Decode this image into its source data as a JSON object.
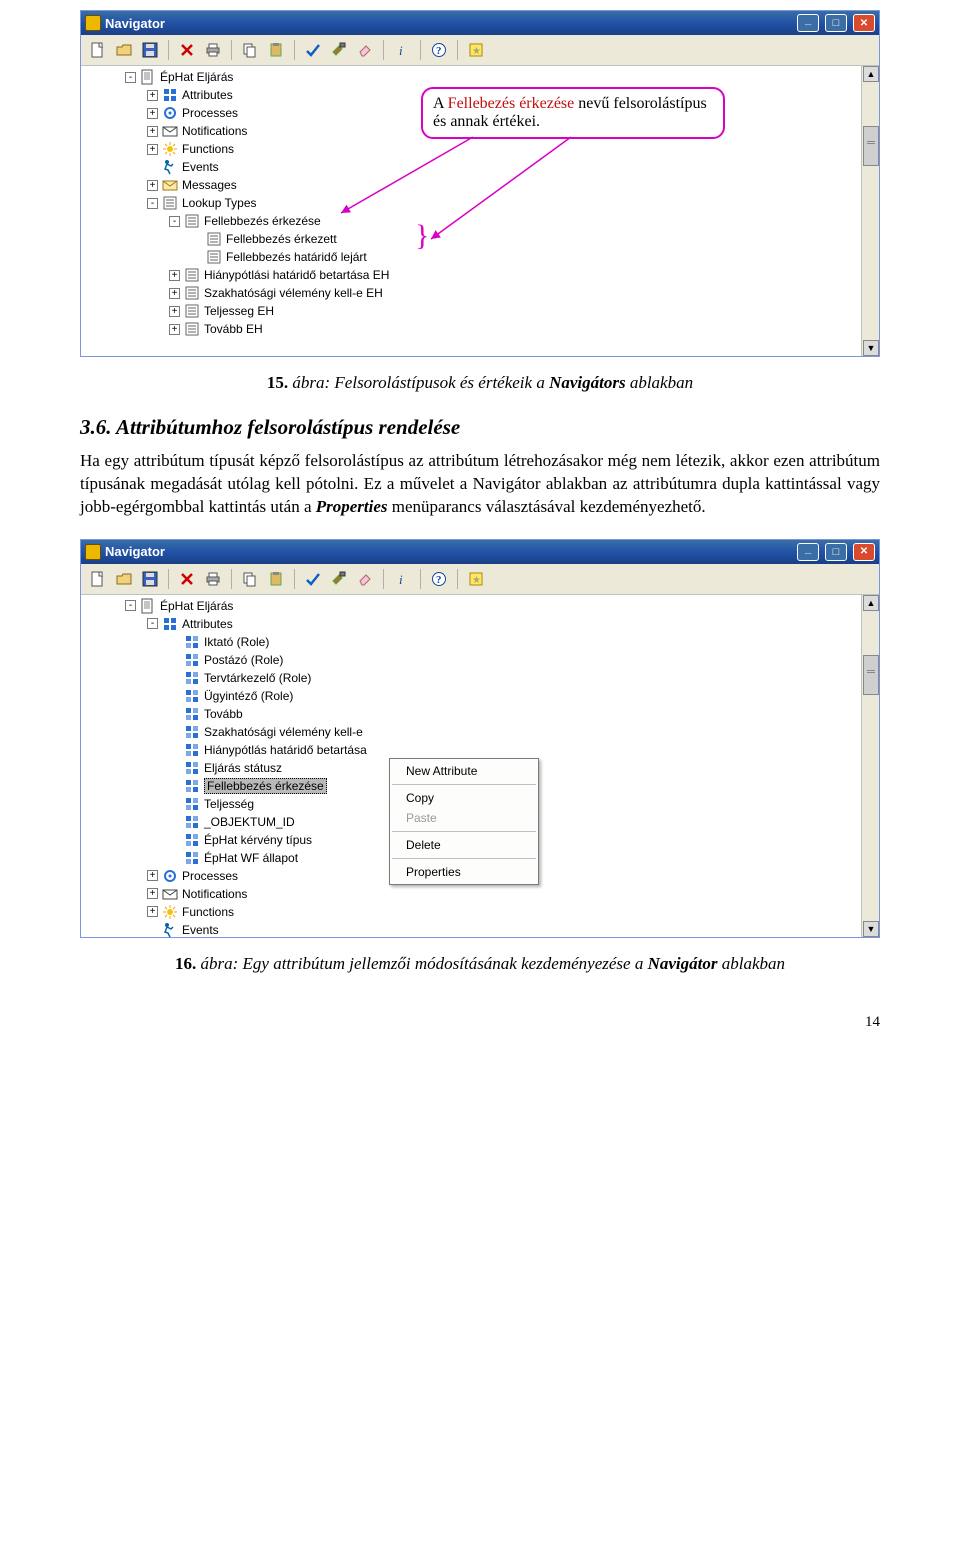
{
  "callout": {
    "line1_prefix": "A ",
    "line1_em": "Fellebezés érkezése",
    "line1_suffix": " nevű felsorolástípus",
    "line2": "és annak értékei."
  },
  "caption1": {
    "num": "15.",
    "text_prefix": " ábra: Felsorolástípusok és értékeik a ",
    "text_em": "Navigátors",
    "text_suffix": " ablakban"
  },
  "heading": "3.6. Attribútumhoz felsorolástípus rendelése",
  "para": {
    "p1": "Ha egy attribútum típusát képző felsorolástípus az attribútum létrehozásakor még nem létezik, akkor ezen attribútum típusának megadását utólag kell pótolni. Ez a művelet a Navigátor ablakban az attribútumra dupla kattintással vagy jobb-egérgombbal kattintás után a ",
    "p1_em": "Properties",
    "p1_suf": " menüparancs választásával kezdeményezhető."
  },
  "caption2": {
    "num": "16.",
    "text_prefix": " ábra: Egy attribútum jellemzői módosításának kezdeményezése a ",
    "text_em": "Navigátor",
    "text_suffix": " ablakban"
  },
  "pagenum": "14",
  "window": {
    "title": "Navigator"
  },
  "toolbar_icons": [
    "new",
    "open",
    "save",
    "delete",
    "print",
    "copy",
    "paste",
    "check",
    "hammer",
    "eraser",
    "italic",
    "help",
    "star"
  ],
  "tree1": [
    {
      "d": 0,
      "exp": "-",
      "icon": "page",
      "label": "ÉpHat Eljárás"
    },
    {
      "d": 1,
      "exp": "+",
      "icon": "grid",
      "label": "Attributes"
    },
    {
      "d": 1,
      "exp": "+",
      "icon": "gear",
      "label": "Processes"
    },
    {
      "d": 1,
      "exp": "+",
      "icon": "mail",
      "label": "Notifications"
    },
    {
      "d": 1,
      "exp": "+",
      "icon": "sun",
      "label": "Functions"
    },
    {
      "d": 1,
      "exp": "",
      "icon": "run",
      "label": "Events"
    },
    {
      "d": 1,
      "exp": "+",
      "icon": "msg",
      "label": "Messages"
    },
    {
      "d": 1,
      "exp": "-",
      "icon": "list",
      "label": "Lookup Types"
    },
    {
      "d": 2,
      "exp": "-",
      "icon": "list",
      "label": "Fellebbezés érkezése"
    },
    {
      "d": 3,
      "exp": "",
      "icon": "list",
      "label": "Fellebbezés érkezett"
    },
    {
      "d": 3,
      "exp": "",
      "icon": "list",
      "label": "Fellebbezés határidő lejárt"
    },
    {
      "d": 2,
      "exp": "+",
      "icon": "list",
      "label": "Hiánypótlási határidő betartása EH"
    },
    {
      "d": 2,
      "exp": "+",
      "icon": "list",
      "label": "Szakhatósági vélemény kell-e EH"
    },
    {
      "d": 2,
      "exp": "+",
      "icon": "list",
      "label": "Teljesseg EH"
    },
    {
      "d": 2,
      "exp": "+",
      "icon": "list",
      "label": "Tovább EH"
    }
  ],
  "tree2": [
    {
      "d": 0,
      "exp": "-",
      "icon": "page",
      "label": "ÉpHat Eljárás"
    },
    {
      "d": 1,
      "exp": "-",
      "icon": "grid",
      "label": "Attributes"
    },
    {
      "d": 2,
      "exp": "",
      "icon": "attr",
      "label": "Iktató (Role)"
    },
    {
      "d": 2,
      "exp": "",
      "icon": "attr",
      "label": "Postázó (Role)"
    },
    {
      "d": 2,
      "exp": "",
      "icon": "attr",
      "label": "Tervtárkezelő (Role)"
    },
    {
      "d": 2,
      "exp": "",
      "icon": "attr",
      "label": "Ügyintéző (Role)"
    },
    {
      "d": 2,
      "exp": "",
      "icon": "attr",
      "label": "Tovább"
    },
    {
      "d": 2,
      "exp": "",
      "icon": "attr",
      "label": "Szakhatósági vélemény kell-e"
    },
    {
      "d": 2,
      "exp": "",
      "icon": "attr",
      "label": "Hiánypótlás határidő betartása"
    },
    {
      "d": 2,
      "exp": "",
      "icon": "attr",
      "label": "Eljárás státusz"
    },
    {
      "d": 2,
      "exp": "",
      "icon": "attr",
      "label": "Fellebbezés érkezése",
      "sel": true
    },
    {
      "d": 2,
      "exp": "",
      "icon": "attr",
      "label": "Teljesség"
    },
    {
      "d": 2,
      "exp": "",
      "icon": "attr",
      "label": "_OBJEKTUM_ID"
    },
    {
      "d": 2,
      "exp": "",
      "icon": "attr",
      "label": "ÉpHat kérvény típus"
    },
    {
      "d": 2,
      "exp": "",
      "icon": "attr",
      "label": "ÉpHat WF állapot"
    },
    {
      "d": 1,
      "exp": "+",
      "icon": "gear",
      "label": "Processes"
    },
    {
      "d": 1,
      "exp": "+",
      "icon": "mail",
      "label": "Notifications"
    },
    {
      "d": 1,
      "exp": "+",
      "icon": "sun",
      "label": "Functions"
    },
    {
      "d": 1,
      "exp": "",
      "icon": "run",
      "label": "Events"
    }
  ],
  "ctxmenu": {
    "new": "New Attribute",
    "copy": "Copy",
    "paste": "Paste",
    "delete": "Delete",
    "properties": "Properties"
  }
}
